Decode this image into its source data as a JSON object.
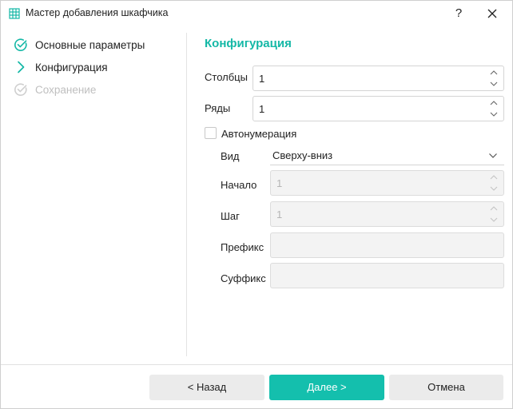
{
  "window": {
    "title": "Мастер добавления шкафчика",
    "help_label": "?",
    "icons": {
      "app": "table-icon",
      "close": "close-icon"
    }
  },
  "steps": [
    {
      "label": "Основные параметры",
      "state": "done",
      "icon": "check-circle-icon"
    },
    {
      "label": "Конфигурация",
      "state": "current",
      "icon": "chevron-right-icon"
    },
    {
      "label": "Сохранение",
      "state": "pending",
      "icon": "check-circle-icon"
    }
  ],
  "config": {
    "title": "Конфигурация",
    "columns": {
      "label": "Столбцы",
      "value": "1"
    },
    "rows": {
      "label": "Ряды",
      "value": "1"
    },
    "autonumbering": {
      "label": "Автонумерация",
      "checked": false
    },
    "view": {
      "label": "Вид",
      "value": "Сверху-вниз"
    },
    "start": {
      "label": "Начало",
      "value": "1"
    },
    "step": {
      "label": "Шаг",
      "value": "1"
    },
    "prefix": {
      "label": "Префикс",
      "value": ""
    },
    "suffix": {
      "label": "Суффикс",
      "value": ""
    }
  },
  "footer": {
    "back_label": "< Назад",
    "next_label": "Далее >",
    "cancel_label": "Отмена"
  },
  "colors": {
    "accent": "#14b8a6",
    "primary_button": "#14bfad",
    "disabled_text": "#bfbfbf"
  }
}
